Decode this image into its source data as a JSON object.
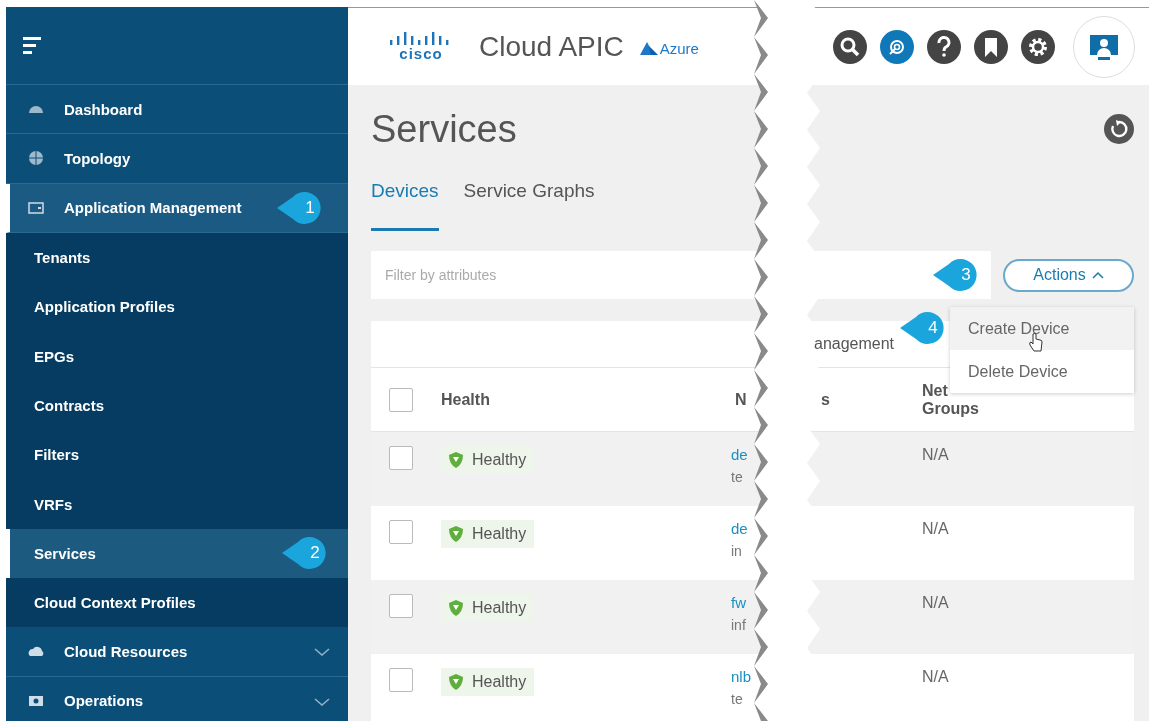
{
  "sidebar": {
    "items": [
      {
        "label": "Dashboard",
        "selected": false
      },
      {
        "label": "Topology",
        "selected": false
      },
      {
        "label": "Application Management",
        "selected": true,
        "expanded": true,
        "callout": "1",
        "children": [
          {
            "label": "Tenants",
            "selected": false
          },
          {
            "label": "Application Profiles",
            "selected": false
          },
          {
            "label": "EPGs",
            "selected": false
          },
          {
            "label": "Contracts",
            "selected": false
          },
          {
            "label": "Filters",
            "selected": false
          },
          {
            "label": "VRFs",
            "selected": false
          },
          {
            "label": "Services",
            "selected": true,
            "callout": "2"
          },
          {
            "label": "Cloud Context Profiles",
            "selected": false
          }
        ]
      },
      {
        "label": "Cloud Resources",
        "selected": false,
        "expanded": false
      },
      {
        "label": "Operations",
        "selected": false,
        "expanded": false
      }
    ]
  },
  "header": {
    "brand": "cisco",
    "product": "Cloud APIC",
    "cloud": "Azure"
  },
  "page": {
    "title": "Services",
    "tabs": [
      {
        "label": "Devices",
        "selected": true
      },
      {
        "label": "Service Graphs",
        "selected": false
      }
    ],
    "filter": {
      "placeholder": "Filter by attributes"
    },
    "actions": {
      "label": "Actions",
      "expanded": true,
      "callout": "3"
    },
    "menu": [
      {
        "label": "Create Device",
        "hovered": true,
        "callout": "4"
      },
      {
        "label": "Delete Device",
        "hovered": false
      }
    ]
  },
  "table": {
    "tab_fragment": "anagement",
    "select_all": {
      "checked": false
    },
    "columns": [
      {
        "label": "Health"
      },
      {
        "label": "N"
      },
      {
        "label": "s"
      },
      {
        "label": "Net Groups"
      }
    ],
    "rows": [
      {
        "checked": false,
        "health": "Healthy",
        "name": "de",
        "detail": "te",
        "column_4": "N/A"
      },
      {
        "checked": false,
        "health": "Healthy",
        "name": "de",
        "detail": "in",
        "column_4": "N/A"
      },
      {
        "checked": false,
        "health": "Healthy",
        "name": "fw",
        "detail": "inf",
        "column_4": "N/A"
      },
      {
        "checked": false,
        "health": "Healthy",
        "name": "nlb",
        "detail": "te",
        "column_4": "N/A"
      }
    ]
  }
}
